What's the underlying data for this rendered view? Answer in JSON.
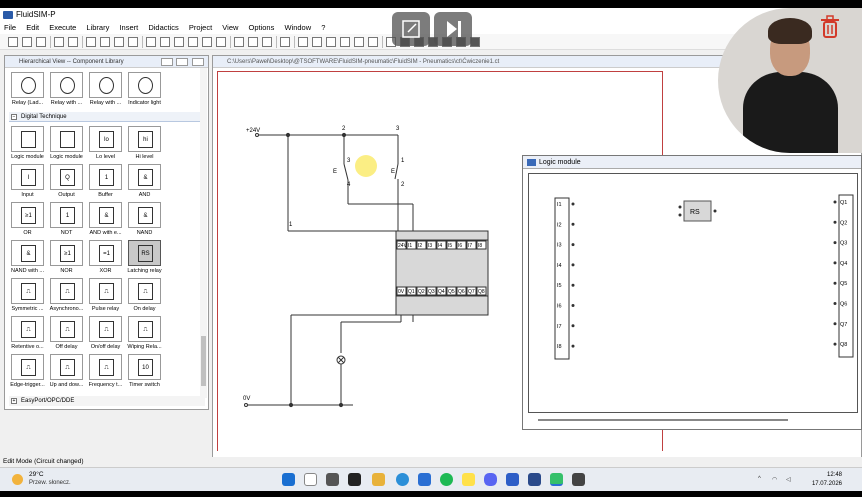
{
  "app": {
    "title": "FluidSIM-P"
  },
  "menu": [
    "File",
    "Edit",
    "Execute",
    "Library",
    "Insert",
    "Didactics",
    "Project",
    "View",
    "Options",
    "Window",
    "?"
  ],
  "library": {
    "title": "Hierarchical View -- Component Library",
    "top_items": [
      "Relay (Lad...",
      "Relay with ...",
      "Relay with ...",
      "Indicator light"
    ],
    "section": "Digital Technique",
    "items": [
      {
        "label": "Logic module",
        "sym": ""
      },
      {
        "label": "Logic module",
        "sym": ""
      },
      {
        "label": "Lo level",
        "sym": "lo"
      },
      {
        "label": "Hi level",
        "sym": "hi"
      },
      {
        "label": "Input",
        "sym": "I"
      },
      {
        "label": "Output",
        "sym": "Q"
      },
      {
        "label": "Buffer",
        "sym": "1"
      },
      {
        "label": "AND",
        "sym": "&"
      },
      {
        "label": "OR",
        "sym": "≥1"
      },
      {
        "label": "NOT",
        "sym": "1"
      },
      {
        "label": "AND with e...",
        "sym": "&"
      },
      {
        "label": "NAND",
        "sym": "&"
      },
      {
        "label": "NAND with ...",
        "sym": "&"
      },
      {
        "label": "NOR",
        "sym": "≥1"
      },
      {
        "label": "XOR",
        "sym": "=1"
      },
      {
        "label": "Latching relay",
        "sym": "RS"
      },
      {
        "label": "Symmetric ...",
        "sym": "⎍"
      },
      {
        "label": "Asynchrono...",
        "sym": "⎍"
      },
      {
        "label": "Pulse relay",
        "sym": "⎍"
      },
      {
        "label": "On delay",
        "sym": "⎍"
      },
      {
        "label": "Retentive o...",
        "sym": "⎍"
      },
      {
        "label": "Off delay",
        "sym": "⎍"
      },
      {
        "label": "On/off delay",
        "sym": "⎍"
      },
      {
        "label": "Wiping Rela...",
        "sym": "⎍"
      },
      {
        "label": "Edge-trigger...",
        "sym": "⎍"
      },
      {
        "label": "Up and dow...",
        "sym": "⎍"
      },
      {
        "label": "Frequency t...",
        "sym": "⎍"
      },
      {
        "label": "Timer switch",
        "sym": "10"
      }
    ],
    "footer_section": "EasyPort/OPC/DDE"
  },
  "circuit": {
    "title": "C:\\Users\\Paweł\\Desktop\\@TSOFTWARE\\FluidSIM-pneumatic\\FluidSIM - Pneumatics\\ct\\Ćwiczenie1.ct",
    "labels": {
      "v24": "+24V",
      "v0": "0V",
      "n2": "2",
      "n3a": "3",
      "n3b": "3",
      "n4": "4",
      "n1a": "1",
      "n2b": "2",
      "n1b": "1",
      "e1": "E",
      "e2": "E"
    },
    "module_inputs": [
      "24V",
      "I1",
      "I2",
      "I3",
      "I4",
      "I5",
      "I6",
      "I7",
      "I8"
    ],
    "module_outputs": [
      "0V",
      "Q1",
      "Q2",
      "Q3",
      "Q4",
      "Q5",
      "Q6",
      "Q7",
      "Q8"
    ]
  },
  "logic": {
    "title": "Logic module",
    "inputs": [
      "I1",
      "I2",
      "I3",
      "I4",
      "I5",
      "I6",
      "I7",
      "I8"
    ],
    "outputs": [
      "Q1",
      "Q2",
      "Q3",
      "Q4",
      "Q5",
      "Q6",
      "Q7",
      "Q8"
    ],
    "block": "RS"
  },
  "status": {
    "text": "Edit Mode (Circuit changed)"
  },
  "taskbar": {
    "temperature": "29°C",
    "weather": "Przew. słonecz.",
    "time": "12:48",
    "date": "17.07.2026"
  },
  "colors": {
    "accent": "#2a5aa8",
    "wire": "#333333",
    "highlight": "#faeb6e",
    "frame": "#c04040"
  }
}
